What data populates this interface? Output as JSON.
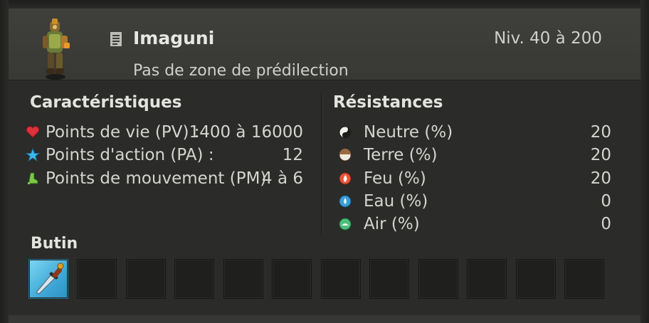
{
  "monster": {
    "name": "Imaguni",
    "level": "Niv. 40 à 200",
    "zone": "Pas de zone de prédilection",
    "portrait_icon": "monster-portrait",
    "doc_icon": "document-icon"
  },
  "characteristics": {
    "title": "Caractéristiques",
    "rows": [
      {
        "label": "Points de vie (PV) :",
        "value": "1400 à 16000",
        "icon": "heart-icon"
      },
      {
        "label": "Points d'action (PA) :",
        "value": "12",
        "icon": "star-icon"
      },
      {
        "label": "Points de mouvement (PM)",
        "value": "4 à 6",
        "icon": "boot-icon"
      }
    ]
  },
  "resistances": {
    "title": "Résistances",
    "rows": [
      {
        "label": "Neutre (%)",
        "value": "20",
        "icon": "neutral-icon"
      },
      {
        "label": "Terre (%)",
        "value": "20",
        "icon": "earth-icon"
      },
      {
        "label": "Feu (%)",
        "value": "20",
        "icon": "fire-icon"
      },
      {
        "label": "Eau (%)",
        "value": "0",
        "icon": "water-icon"
      },
      {
        "label": "Air (%)",
        "value": "0",
        "icon": "air-icon"
      }
    ]
  },
  "loot": {
    "title": "Butin",
    "item_icon": "dagger-icon",
    "slot_count": 12
  },
  "colors": {
    "heart": "#e0303a",
    "star": "#3ab8f0",
    "boot": "#7cc84a",
    "fire": "#e8553a",
    "water": "#3aa0d8",
    "air": "#4fbf7a",
    "earth": "#9a6a42"
  }
}
